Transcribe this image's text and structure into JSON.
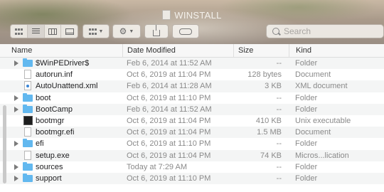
{
  "window": {
    "title": "WINSTALL"
  },
  "toolbar": {
    "view_modes": [
      "icon-view",
      "list-view",
      "column-view",
      "gallery-view"
    ],
    "search_placeholder": "Search"
  },
  "columns": {
    "name": "Name",
    "date": "Date Modified",
    "size": "Size",
    "kind": "Kind"
  },
  "files": [
    {
      "name": "$WinPEDriver$",
      "date": "Feb 6, 2014 at 11:52 AM",
      "size": "--",
      "kind": "Folder",
      "icon": "folder-icon",
      "expandable": true
    },
    {
      "name": "autorun.inf",
      "date": "Oct 6, 2019 at 11:04 PM",
      "size": "128 bytes",
      "kind": "Document",
      "icon": "document-icon",
      "expandable": false
    },
    {
      "name": "AutoUnattend.xml",
      "date": "Feb 6, 2014 at 11:28 AM",
      "size": "3 KB",
      "kind": "XML document",
      "icon": "xml-file-icon",
      "expandable": false
    },
    {
      "name": "boot",
      "date": "Oct 6, 2019 at 11:10 PM",
      "size": "--",
      "kind": "Folder",
      "icon": "folder-icon",
      "expandable": true
    },
    {
      "name": "BootCamp",
      "date": "Feb 6, 2014 at 11:52 AM",
      "size": "--",
      "kind": "Folder",
      "icon": "folder-icon",
      "expandable": true
    },
    {
      "name": "bootmgr",
      "date": "Oct 6, 2019 at 11:04 PM",
      "size": "410 KB",
      "kind": "Unix executable",
      "icon": "executable-icon",
      "expandable": false
    },
    {
      "name": "bootmgr.efi",
      "date": "Oct 6, 2019 at 11:04 PM",
      "size": "1.5 MB",
      "kind": "Document",
      "icon": "document-icon",
      "expandable": false
    },
    {
      "name": "efi",
      "date": "Oct 6, 2019 at 11:10 PM",
      "size": "--",
      "kind": "Folder",
      "icon": "folder-icon",
      "expandable": true
    },
    {
      "name": "setup.exe",
      "date": "Oct 6, 2019 at 11:04 PM",
      "size": "74 KB",
      "kind": "Micros...lication",
      "icon": "document-icon",
      "expandable": false
    },
    {
      "name": "sources",
      "date": "Today at 7:29 AM",
      "size": "--",
      "kind": "Folder",
      "icon": "folder-icon",
      "expandable": true
    },
    {
      "name": "support",
      "date": "Oct 6, 2019 at 11:10 PM",
      "size": "--",
      "kind": "Folder",
      "icon": "folder-icon",
      "expandable": true
    }
  ]
}
